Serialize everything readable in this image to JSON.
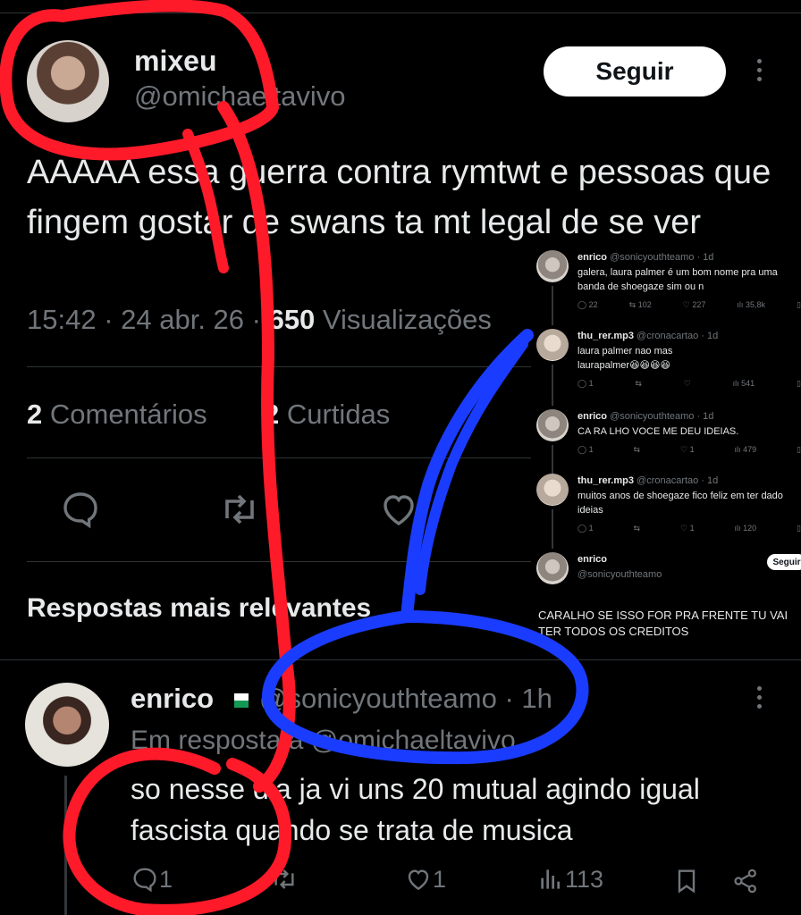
{
  "post": {
    "display_name": "mixeu",
    "handle": "@omichaeltavivo",
    "follow_label": "Seguir",
    "text": "AAAAA essa guerra contra rymtwt e pessoas que fingem gostar de swans ta mt legal de se ver",
    "time": "15:42 · 24 abr. 26 · ",
    "views_count": "650",
    "views_label": " Visualizações",
    "comments_count": "2",
    "comments_label": " Comentários",
    "likes_count": "2",
    "likes_label": " Curtidas",
    "icons": [
      "reply-icon",
      "retweet-icon",
      "like-icon"
    ]
  },
  "section_title": "Respostas mais relevantes",
  "reply": {
    "display_name": "enrico",
    "handle": "@sonicyouthteamo · 1h",
    "replying_to": "Em resposta a @omichaeltavivo",
    "text": "so nesse dia ja vi uns 20 mutual agindo igual fascista quando se trata de musica",
    "reply_count": "1",
    "like_count": "1",
    "view_count": "113",
    "icons": [
      "reply-icon",
      "retweet-icon",
      "like-icon",
      "views-icon",
      "bookmark-icon",
      "share-icon"
    ]
  },
  "embedded": {
    "posts": [
      {
        "name": "enrico",
        "meta": "@sonicyouthteamo · 1d",
        "text": "galera, laura palmer é um bom nome pra uma banda de shoegaze sim ou n",
        "replies": "22",
        "retweets": "102",
        "likes": "227",
        "views": "35,8k"
      },
      {
        "name": "thu_rer.mp3",
        "meta": "@cronacartao · 1d",
        "text": "laura palmer nao mas laurapalmer😆😆😆😆",
        "replies": "1",
        "retweets": "",
        "likes": "",
        "views": "541"
      },
      {
        "name": "enrico",
        "meta": "@sonicyouthteamo · 1d",
        "text": "CA RA LHO VOCE ME DEU IDEIAS.",
        "replies": "1",
        "retweets": "",
        "likes": "1",
        "views": "479"
      },
      {
        "name": "thu_rer.mp3",
        "meta": "@cronacartao · 1d",
        "text": "muitos anos de shoegaze fico feliz em ter dado ideias",
        "replies": "1",
        "retweets": "",
        "likes": "1",
        "views": "120"
      }
    ],
    "last": {
      "name": "enrico",
      "handle": "@sonicyouthteamo",
      "follow_label": "Seguir",
      "text": "CARALHO SE ISSO FOR PRA FRENTE TU VAI TER TODOS OS CREDITOS"
    }
  },
  "annotations": {
    "red_color": "#ff1a2a",
    "blue_color": "#1a3cff"
  }
}
